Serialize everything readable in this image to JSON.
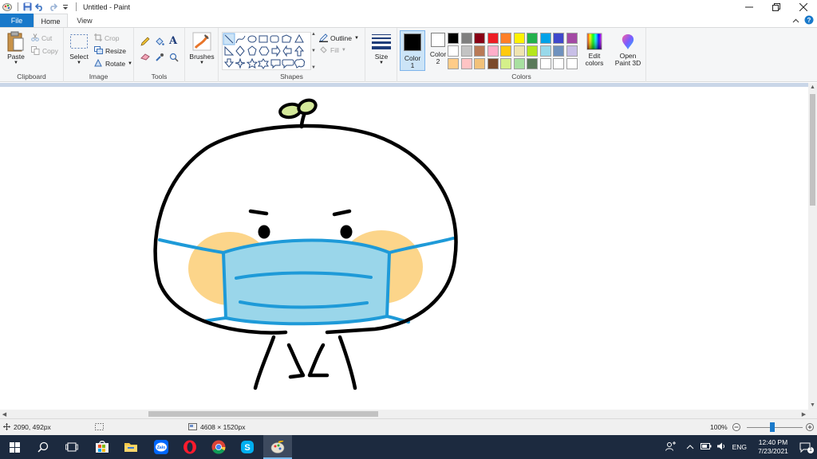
{
  "window": {
    "title": "Untitled - Paint"
  },
  "tabs": {
    "file": "File",
    "home": "Home",
    "view": "View"
  },
  "ribbon": {
    "clipboard": {
      "paste": "Paste",
      "cut": "Cut",
      "copy": "Copy",
      "label": "Clipboard"
    },
    "image": {
      "select": "Select",
      "crop": "Crop",
      "resize": "Resize",
      "rotate": "Rotate",
      "label": "Image"
    },
    "tools": {
      "label": "Tools"
    },
    "brushes": {
      "label": "Brushes"
    },
    "shapes": {
      "outline": "Outline",
      "fill": "Fill",
      "label": "Shapes"
    },
    "size": {
      "label": "Size"
    },
    "colors": {
      "color1": "Color",
      "color1_num": "1",
      "color2": "Color",
      "color2_num": "2",
      "edit_colors_1": "Edit",
      "edit_colors_2": "colors",
      "open_p3d_1": "Open",
      "open_p3d_2": "Paint 3D",
      "label": "Colors",
      "color1_value": "#000000",
      "color2_value": "#ffffff",
      "palette": [
        "#000000",
        "#7f7f7f",
        "#880015",
        "#ed1c24",
        "#ff7f27",
        "#fff200",
        "#22b14c",
        "#00a2e8",
        "#3f48cc",
        "#a349a4",
        "#ffffff",
        "#c3c3c3",
        "#b97a57",
        "#ffaec9",
        "#ffc90e",
        "#efe4b0",
        "#b5e61d",
        "#99d9ea",
        "#7092be",
        "#c8bfe7",
        "#ffcc88",
        "#ffc4c4",
        "#f2c27a",
        "#7b4a2a",
        "#d5f08a",
        "#a8e0a0",
        "#5a7a5a",
        "#ffffff",
        "#ffffff",
        "#ffffff"
      ]
    }
  },
  "status": {
    "cursor_pos": "2090, 492px",
    "canvas_size": "4608 × 1520px",
    "zoom": "100%"
  },
  "taskbar": {
    "language": "ENG",
    "time": "12:40 PM",
    "date": "7/23/2021",
    "notification_count": "1"
  },
  "drawing": {
    "outline_color": "#000000",
    "mask_color": "#9ad6ea",
    "mask_line_color": "#1e9ad8",
    "cheek_color": "#fcd58a",
    "sprout_color": "#d4e89a"
  }
}
